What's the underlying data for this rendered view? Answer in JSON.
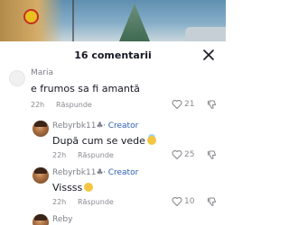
{
  "header": {
    "title": "16 comentarii"
  },
  "comments": [
    {
      "username": "Maria",
      "text": "e frumos sa fi amantă",
      "time": "22h",
      "reply_label": "Răspunde",
      "likes": "21",
      "is_creator": false,
      "emoji": ""
    },
    {
      "username": "Rebyrbk11",
      "creator_label": "· Creator",
      "text": "După cum se vede",
      "emoji": "halo-smile",
      "time": "22h",
      "reply_label": "Răspunde",
      "likes": "25",
      "is_creator": true
    },
    {
      "username": "Rebyrbk11",
      "creator_label": "· Creator",
      "text": "Vissss",
      "emoji": "smile",
      "time": "22h",
      "reply_label": "Răspunde",
      "likes": "10",
      "is_creator": true
    },
    {
      "username": "Reby",
      "is_creator": true
    }
  ],
  "icons": [
    "close-icon",
    "heart-icon",
    "thumbs-down-icon",
    "club-icon"
  ]
}
